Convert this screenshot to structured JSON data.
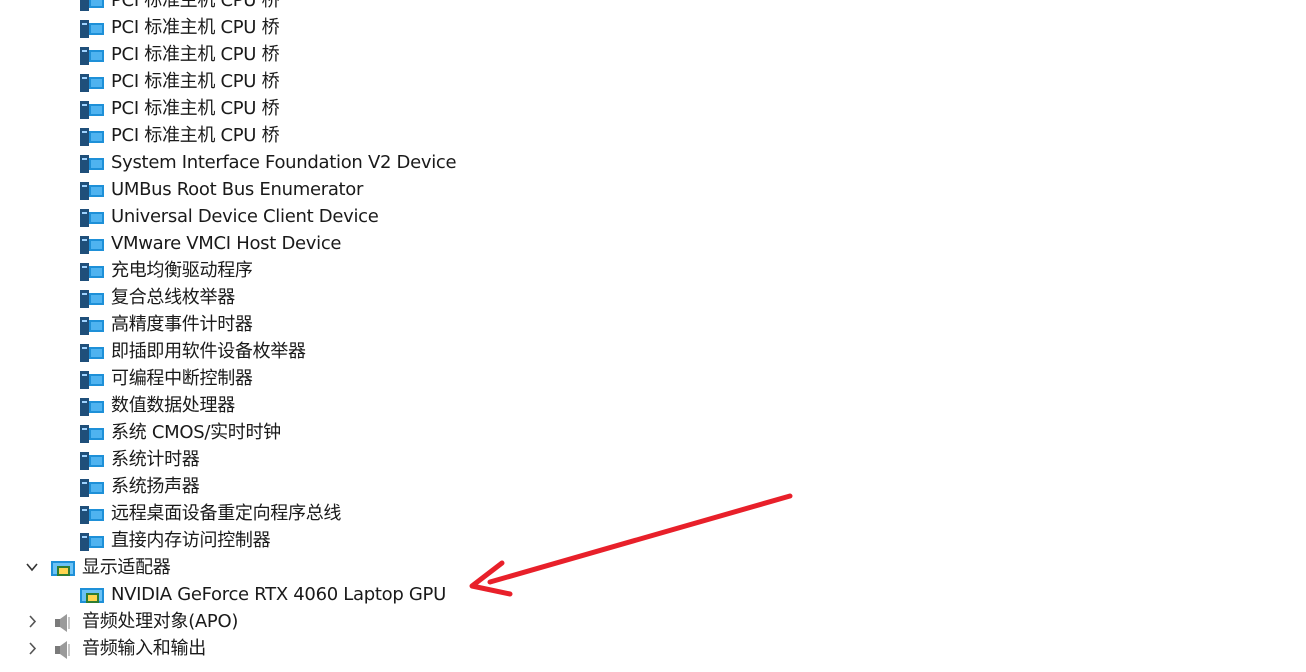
{
  "system_devices": [
    "PCI 标准主机 CPU 桥",
    "PCI 标准主机 CPU 桥",
    "PCI 标准主机 CPU 桥",
    "PCI 标准主机 CPU 桥",
    "PCI 标准主机 CPU 桥",
    "PCI 标准主机 CPU 桥",
    "System Interface Foundation V2 Device",
    "UMBus Root Bus Enumerator",
    "Universal Device Client Device",
    "VMware VMCI Host Device",
    "充电均衡驱动程序",
    "复合总线枚举器",
    "高精度事件计时器",
    "即插即用软件设备枚举器",
    "可编程中断控制器",
    "数值数据处理器",
    "系统 CMOS/实时时钟",
    "系统计时器",
    "系统扬声器",
    "远程桌面设备重定向程序总线",
    "直接内存访问控制器"
  ],
  "display_adapters": {
    "label": "显示适配器",
    "expanded": true,
    "expand_icon": "chevron-down-icon",
    "icon": "display-adapter-icon",
    "children": [
      "NVIDIA GeForce RTX 4060 Laptop GPU"
    ]
  },
  "collapsed_categories": [
    {
      "label": "音频处理对象(APO)",
      "icon": "speaker-icon",
      "expand_icon": "chevron-right-icon"
    },
    {
      "label": "音频输入和输出",
      "icon": "speaker-icon",
      "expand_icon": "chevron-right-icon"
    }
  ],
  "annotation": {
    "type": "arrow",
    "color": "#e8202a",
    "points_to": "NVIDIA GeForce RTX 4060 Laptop GPU"
  },
  "colors": {
    "system_icon_blue": "#1e90d8",
    "system_icon_dark": "#1f4f7a",
    "adapter_icon_green": "#4caf50"
  }
}
